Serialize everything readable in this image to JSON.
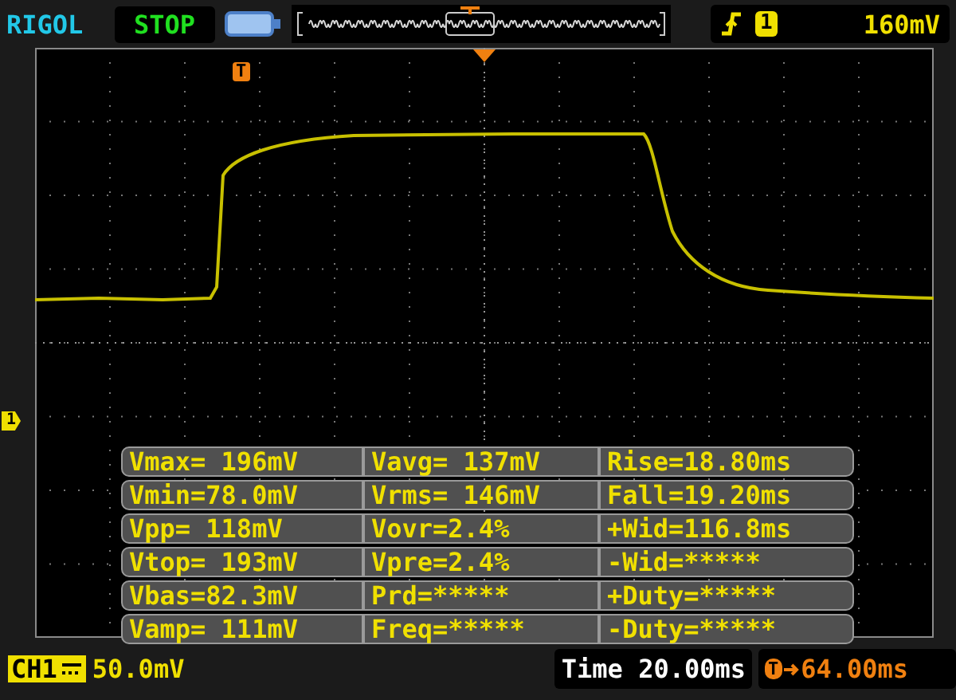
{
  "header": {
    "brand": "RIGOL",
    "run_state": "STOP",
    "trigger": {
      "channel": "1",
      "level": "160mV"
    }
  },
  "screen": {
    "trigger_marker": "T",
    "channel_marker": "1"
  },
  "measurements": [
    [
      "Vmax= 196mV",
      "Vavg= 137mV",
      "Rise=18.80ms"
    ],
    [
      "Vmin=78.0mV",
      "Vrms= 146mV",
      "Fall=19.20ms"
    ],
    [
      "Vpp= 118mV",
      "Vovr=2.4%",
      "+Wid=116.8ms"
    ],
    [
      "Vtop= 193mV",
      "Vpre=2.4%",
      "-Wid=*****"
    ],
    [
      "Vbas=82.3mV",
      "Prd=*****",
      "+Duty=*****"
    ],
    [
      "Vamp= 111mV",
      "Freq=*****",
      "-Duty=*****"
    ]
  ],
  "footer": {
    "channel": {
      "label": "CH1",
      "scale": "50.0mV"
    },
    "timebase": {
      "label": "Time",
      "value": "20.00ms"
    },
    "trigger_offset": {
      "marker": "T",
      "value": "64.00ms"
    }
  }
}
